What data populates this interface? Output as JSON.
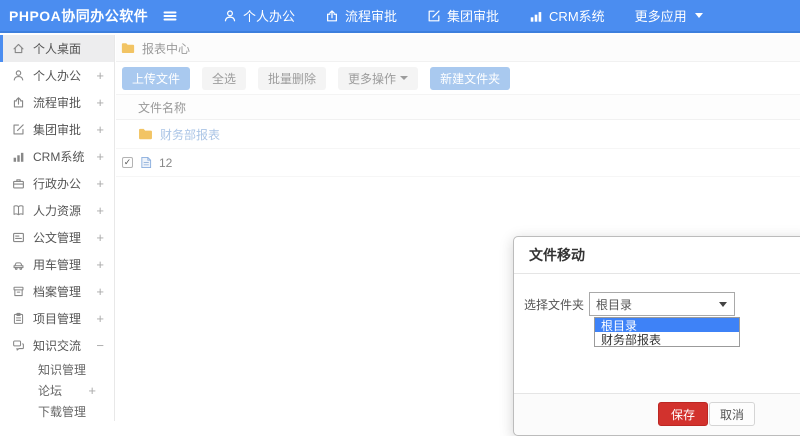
{
  "navbar": {
    "logo": "PHPOA协同办公软件",
    "items": [
      {
        "label": "个人办公",
        "icon": "user-icon"
      },
      {
        "label": "流程审批",
        "icon": "process-icon"
      },
      {
        "label": "集团审批",
        "icon": "edit-square-icon"
      },
      {
        "label": "CRM系统",
        "icon": "bar-chart-icon"
      },
      {
        "label": "更多应用",
        "icon": "caret-down-icon"
      }
    ]
  },
  "sidebar": {
    "items": [
      {
        "label": "个人桌面",
        "icon": "home-icon",
        "expand": "",
        "active": true
      },
      {
        "label": "个人办公",
        "icon": "user-icon",
        "expand": "+"
      },
      {
        "label": "流程审批",
        "icon": "process-icon",
        "expand": "+"
      },
      {
        "label": "集团审批",
        "icon": "edit-square-icon",
        "expand": "+"
      },
      {
        "label": "CRM系统",
        "icon": "bar-chart-icon",
        "expand": "+"
      },
      {
        "label": "行政办公",
        "icon": "briefcase-icon",
        "expand": "+"
      },
      {
        "label": "人力资源",
        "icon": "book-icon",
        "expand": "+"
      },
      {
        "label": "公文管理",
        "icon": "doc-card-icon",
        "expand": "+"
      },
      {
        "label": "用车管理",
        "icon": "car-icon",
        "expand": "+"
      },
      {
        "label": "档案管理",
        "icon": "archive-icon",
        "expand": "+"
      },
      {
        "label": "项目管理",
        "icon": "clipboard-icon",
        "expand": "+"
      },
      {
        "label": "知识交流",
        "icon": "chat-icon",
        "expand": "−",
        "expanded": true
      }
    ],
    "subitems": [
      {
        "label": "知识管理",
        "expand": ""
      },
      {
        "label": "论坛",
        "expand": "+"
      },
      {
        "label": "下载管理",
        "expand": ""
      }
    ]
  },
  "main": {
    "breadcrumb": "报表中心",
    "toolbar": {
      "upload": "上传文件",
      "select_all": "全选",
      "batch_delete": "批量删除",
      "more_actions": "更多操作",
      "new_folder": "新建文件夹"
    },
    "table": {
      "header": "文件名称",
      "rows": [
        {
          "name": "财务部报表",
          "type": "folder"
        },
        {
          "name": "12",
          "type": "file",
          "checked": true
        }
      ]
    }
  },
  "modal": {
    "title": "文件移动",
    "field_label": "选择文件夹",
    "select_value": "根目录",
    "options": [
      {
        "label": "根目录",
        "selected": true
      },
      {
        "label": "财务部报表",
        "selected": false
      }
    ],
    "save_label": "保存",
    "cancel_label": "取消"
  },
  "glyphs": {
    "check": "✓"
  },
  "colors": {
    "navbar_blue": "#4b8df0",
    "primary_button_blue": "#a9c9ef",
    "folder_yellow": "#f2c464",
    "link_blue": "#abc5e6",
    "option_highlight_blue": "#3e82f7",
    "save_red": "#d2322d"
  }
}
